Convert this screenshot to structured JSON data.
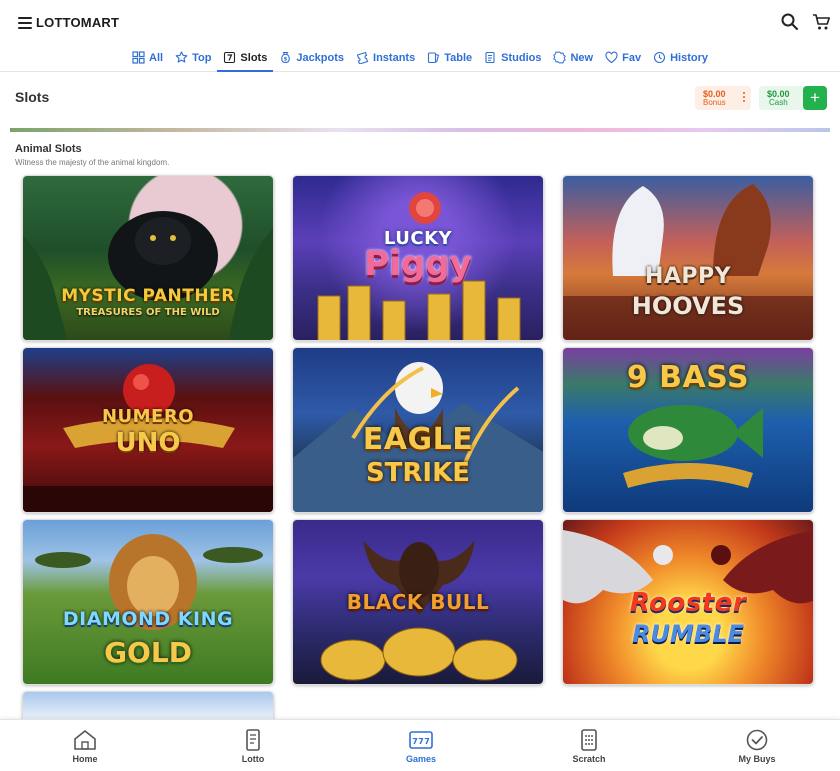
{
  "header": {
    "logo": "LOTTOMART",
    "icons": [
      "menu-icon",
      "search-icon",
      "cart-icon"
    ]
  },
  "nav": {
    "tabs": [
      {
        "label": "All",
        "icon": "grid-icon"
      },
      {
        "label": "Top",
        "icon": "star-icon"
      },
      {
        "label": "Slots",
        "icon": "slot-seven-icon",
        "active": true
      },
      {
        "label": "Jackpots",
        "icon": "money-bag-icon"
      },
      {
        "label": "Instants",
        "icon": "ticket-icon"
      },
      {
        "label": "Table",
        "icon": "cards-icon"
      },
      {
        "label": "Studios",
        "icon": "studio-icon"
      },
      {
        "label": "New",
        "icon": "badge-icon"
      },
      {
        "label": "Fav",
        "icon": "heart-icon"
      },
      {
        "label": "History",
        "icon": "clock-icon"
      }
    ]
  },
  "page": {
    "title": "Slots",
    "bonus": {
      "amount": "$0.00",
      "label": "Bonus"
    },
    "cash": {
      "amount": "$0.00",
      "label": "Cash",
      "add": "+"
    }
  },
  "section": {
    "title": "Animal Slots",
    "subtitle": "Witness the majesty of the animal kingdom."
  },
  "games": [
    {
      "title": "MYSTIC PANTHER",
      "subtitle": "TREASURES OF THE WILD"
    },
    {
      "title": "LUCKY",
      "subtitle": "Piggy"
    },
    {
      "title": "HAPPY",
      "subtitle": "HOOVES"
    },
    {
      "title": "NUMERO",
      "subtitle": "UNO"
    },
    {
      "title": "EAGLE",
      "subtitle": "STRIKE"
    },
    {
      "title": "9 BASS",
      "subtitle": ""
    },
    {
      "title": "DIAMOND KING",
      "subtitle": "GOLD"
    },
    {
      "title": "BLACK BULL",
      "subtitle": ""
    },
    {
      "title": "Rooster",
      "subtitle": "RUMBLE"
    }
  ],
  "bottom_nav": [
    {
      "label": "Home",
      "icon": "home-icon"
    },
    {
      "label": "Lotto",
      "icon": "lotto-ticket-icon"
    },
    {
      "label": "Games",
      "icon": "slot-machine-icon",
      "active": true
    },
    {
      "label": "Scratch",
      "icon": "scratch-card-icon"
    },
    {
      "label": "My Buys",
      "icon": "check-circle-icon"
    }
  ],
  "colors": {
    "accent": "#2f6fd6",
    "bonus": "#e85d1a",
    "cash": "#1c9a3f",
    "add_button": "#22b14c"
  }
}
